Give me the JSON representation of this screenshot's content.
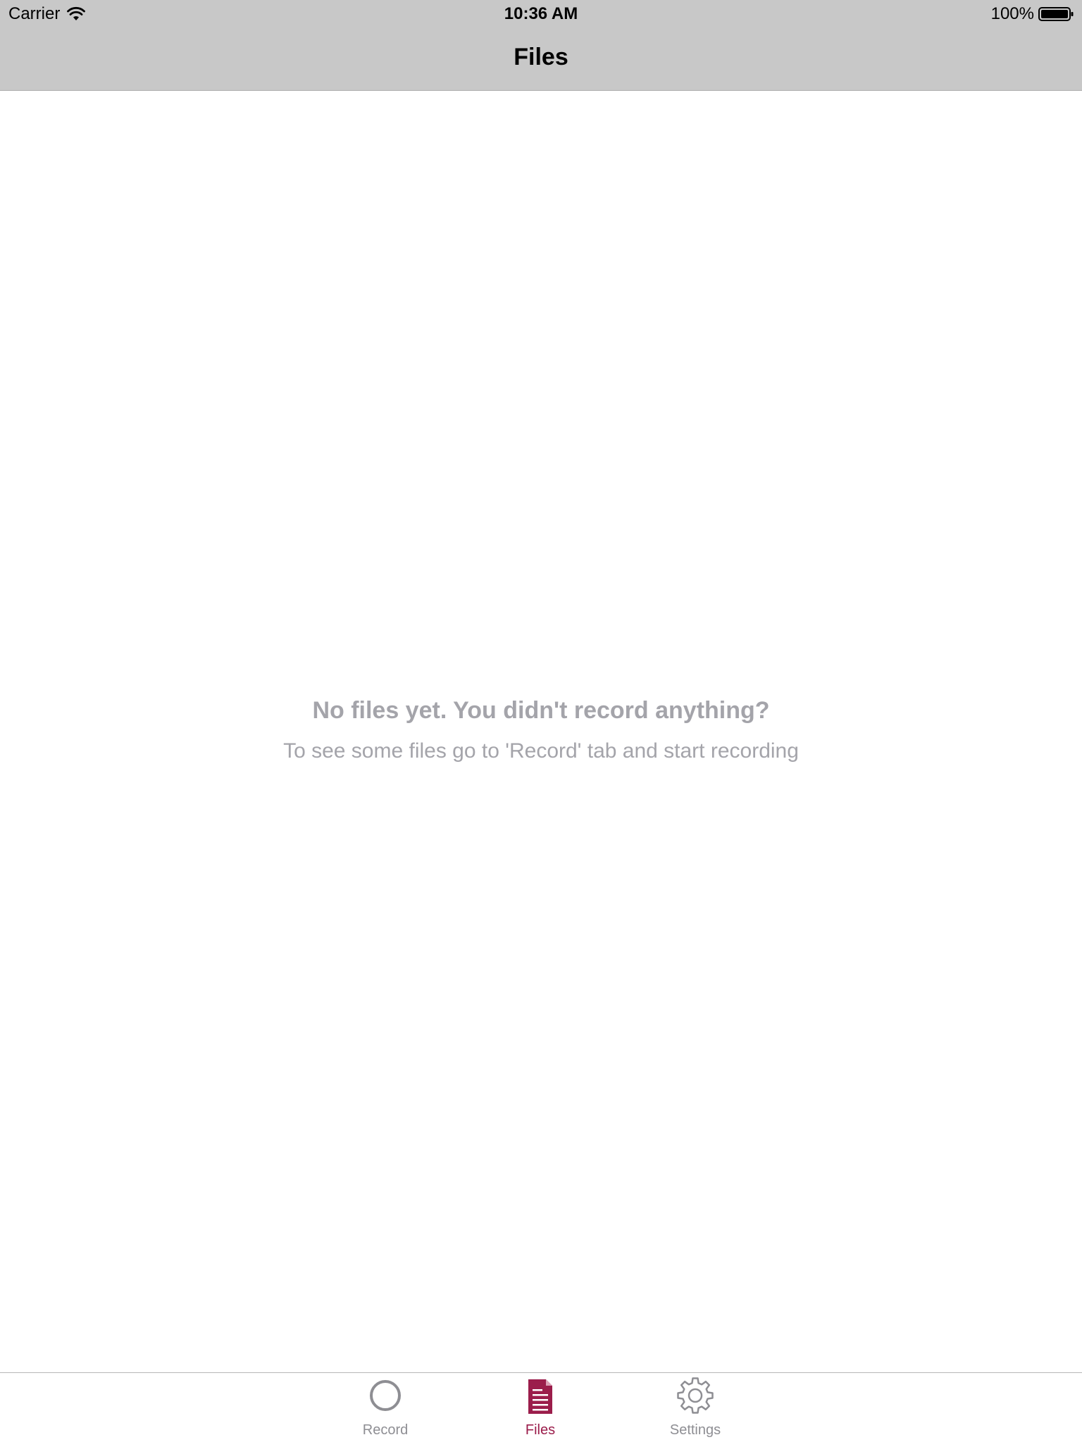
{
  "status_bar": {
    "carrier": "Carrier",
    "time": "10:36 AM",
    "battery": "100%"
  },
  "nav": {
    "title": "Files"
  },
  "empty_state": {
    "title": "No files yet. You didn't record anything?",
    "subtitle": "To see some files go to 'Record' tab and start recording"
  },
  "tabs": [
    {
      "label": "Record",
      "icon": "circle-icon",
      "active": false
    },
    {
      "label": "Files",
      "icon": "document-icon",
      "active": true
    },
    {
      "label": "Settings",
      "icon": "gear-icon",
      "active": false
    }
  ],
  "colors": {
    "header_bg": "#c8c8c8",
    "accent": "#9b1d4b",
    "inactive_tab": "#8e8e93",
    "placeholder_text": "#a4a4aa"
  }
}
